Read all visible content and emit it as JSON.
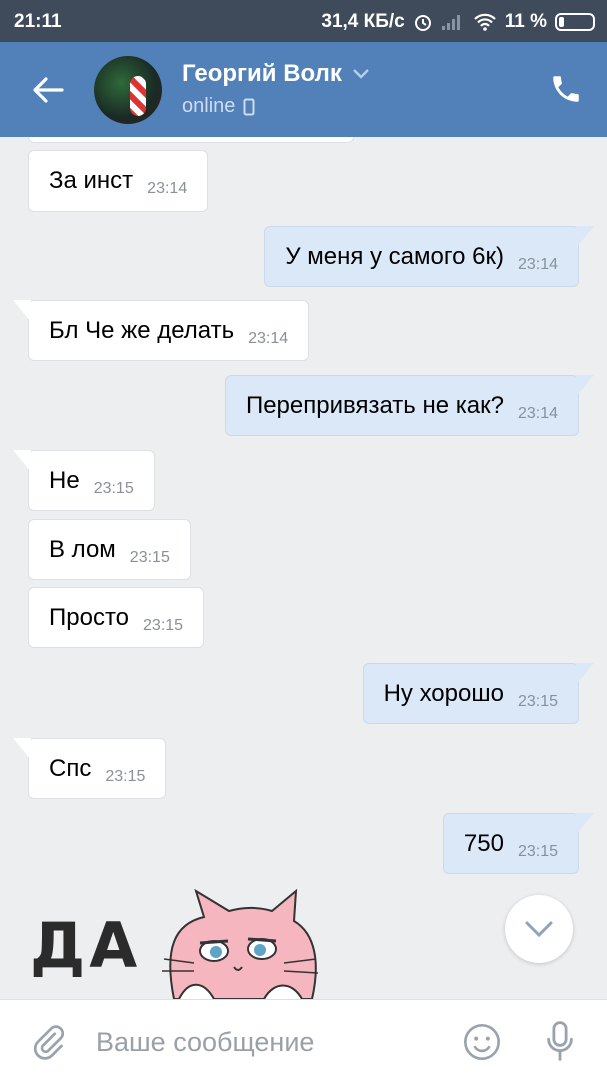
{
  "status_bar": {
    "time": "21:11",
    "network_speed": "31,4 КБ/с",
    "battery": "11 %"
  },
  "header": {
    "contact_name": "Георгий Волк",
    "presence": "online"
  },
  "messages": [
    {
      "text": "За инст",
      "time": "23:14",
      "direction": "in"
    },
    {
      "text": "У меня у самого 6к)",
      "time": "23:14",
      "direction": "out"
    },
    {
      "text": "Бл Че же делать",
      "time": "23:14",
      "direction": "in"
    },
    {
      "text": "Перепривязать не как?",
      "time": "23:14",
      "direction": "out"
    },
    {
      "text": "Не",
      "time": "23:15",
      "direction": "in"
    },
    {
      "text": "В лом",
      "time": "23:15",
      "direction": "in"
    },
    {
      "text": "Просто",
      "time": "23:15",
      "direction": "in"
    },
    {
      "text": "Ну хорошо",
      "time": "23:15",
      "direction": "out"
    },
    {
      "text": "Спс",
      "time": "23:15",
      "direction": "in"
    },
    {
      "text": "750",
      "time": "23:15",
      "direction": "out"
    }
  ],
  "sticker": {
    "text": "ДА"
  },
  "composer": {
    "placeholder": "Ваше сообщение"
  },
  "colors": {
    "header": "#5181b8",
    "statusbar": "#3f4a5a",
    "outgoing_bubble": "#dbe8f8",
    "background": "#edeef0"
  }
}
